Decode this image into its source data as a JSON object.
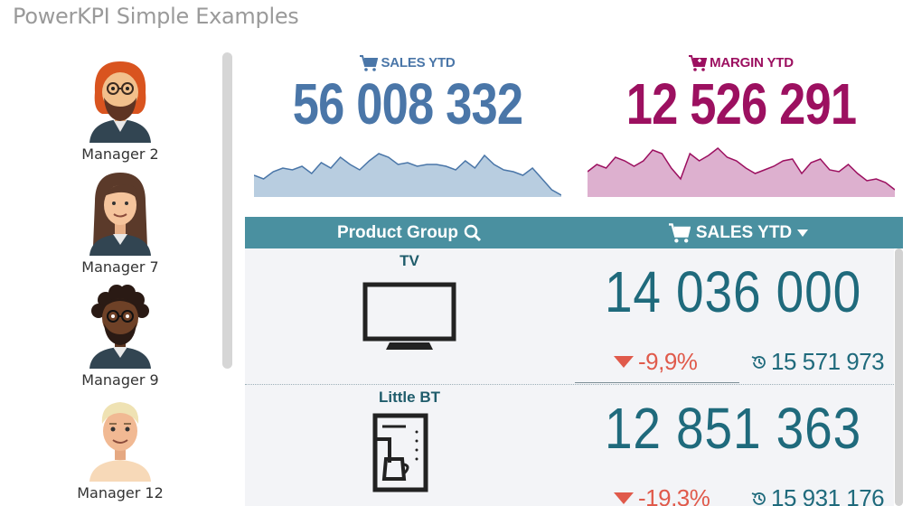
{
  "page": {
    "title": "PowerKPI Simple Examples"
  },
  "managers": [
    {
      "name": "Manager 2",
      "hair": "#d9541f",
      "skin": "#f2c08c",
      "style": "redhead"
    },
    {
      "name": "Manager 7",
      "hair": "#5b3a2a",
      "skin": "#f5c49c",
      "style": "longhair"
    },
    {
      "name": "Manager 9",
      "hair": "#2a1a14",
      "skin": "#6e4127",
      "style": "curly"
    },
    {
      "name": "Manager 12",
      "hair": "#efe2b3",
      "skin": "#f1b993",
      "style": "blond"
    }
  ],
  "kpis": {
    "sales": {
      "label": "SALES YTD",
      "value": "56 008 332",
      "color": "#4a76a8",
      "icon": "cart-icon",
      "spark_color": "#b8cde0",
      "spark_stroke": "#4a76a8",
      "spark": [
        12,
        10,
        14,
        16,
        15,
        17,
        13,
        19,
        16,
        22,
        18,
        15,
        20,
        24,
        22,
        18,
        19,
        17,
        18,
        18,
        17,
        15,
        20,
        16,
        23,
        18,
        15,
        14,
        12,
        16,
        10,
        4,
        1
      ]
    },
    "margin": {
      "label": "MARGIN YTD",
      "value": "12 526 291",
      "color": "#9c1060",
      "icon": "cart-plus-icon",
      "spark_color": "#ddb0cf",
      "spark_stroke": "#9c1060",
      "spark": [
        14,
        18,
        16,
        22,
        20,
        17,
        20,
        26,
        24,
        16,
        10,
        24,
        20,
        23,
        27,
        22,
        20,
        16,
        13,
        15,
        17,
        20,
        21,
        13,
        19,
        21,
        15,
        14,
        18,
        13,
        9,
        10,
        8,
        4
      ]
    }
  },
  "table": {
    "header": {
      "product_group": "Product Group",
      "sales_ytd": "SALES YTD",
      "search_icon": "search-icon",
      "sort_icon": "caret-down-icon",
      "cart_icon": "cart-icon"
    },
    "rows": [
      {
        "name": "TV",
        "icon": "tv-icon",
        "value": "14 036 000",
        "delta": "-9,9%",
        "previous": "15 571 973"
      },
      {
        "name": "Little BT",
        "icon": "coffee-maker-icon",
        "value": "12 851 363",
        "delta": "-19,3%",
        "previous": "15 931 176"
      }
    ],
    "header_color": "#4a90a0",
    "value_color": "#1f6a7c",
    "negative_color": "#e05a4b"
  }
}
